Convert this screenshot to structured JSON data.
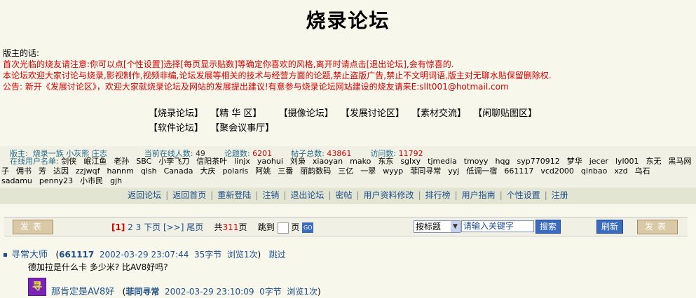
{
  "title": "烧录论坛",
  "notice": {
    "head": "版主的话:",
    "line1": "首次光临的烧友请注意:你可以点[个性设置]选择[每页显示贴数]等确定你喜欢的风格,离开时请点击[退出论坛],会有惊喜的.",
    "line2": "本论坛欢迎大家讨论与烧录,影视制作,视频非编,论坛发展等相关的技术与经营方面的论题,禁止盗版广告,禁止不文明词语,版主对无聊水贴保留删除权.",
    "line3": "公告: 新开《发展讨论区》，欢迎大家就烧录论坛及网站的发展提出建议!有意参与烧录论坛网站建设的烧友请来E:sllt001@hotmail.com"
  },
  "nav": {
    "row1": [
      "【烧录论坛】",
      "【精 华 区】",
      "【摄像论坛】",
      "【发展讨论区】",
      "【素材交流】",
      "【闲聊贴图区】"
    ],
    "row2": [
      "【软件论坛】",
      "【聚会议事厅】"
    ]
  },
  "stats": {
    "moderators_label": "版主:",
    "moderators": "烧录一族 小灰熊 庄志",
    "online_label": "当前在线人数:",
    "online": "49",
    "topics_label": "论题数:",
    "topics": "6201",
    "posts_label": "帖子总数:",
    "posts": "43861",
    "visits_label": "访问数:",
    "visits": "11792"
  },
  "online_users": {
    "label": "在线用户名单:",
    "users": [
      "剑侠",
      "岷江鱼",
      "老孙",
      "SBC",
      "小李飞刀",
      "信阳茶叶",
      "linjx",
      "yaohui",
      "刘枭",
      "xiaoyan",
      "mako",
      "东东",
      "sglxy",
      "tjmedia",
      "tmoyy",
      "hqg",
      "syp770912",
      "梦华",
      "jecer",
      "lyl001",
      "东无",
      "黑马网子",
      "佣书",
      "芳",
      "达因",
      "zzjwqf",
      "hannm",
      "qlsh",
      "Canada",
      "大庆",
      "polaris",
      "阿姚",
      "三番",
      "丽韵数码",
      "三亿",
      "一翠",
      "wyyp",
      "菲同寻常",
      "yyj",
      "低调一宿",
      "661117",
      "vcd2000",
      "qinbao",
      "xzd",
      "乌石",
      "sadamu",
      "penny23",
      "小市民",
      "gjh"
    ]
  },
  "menu": [
    "返回论坛",
    "返回首页",
    "重新登陆",
    "注销",
    "退出论坛",
    "密帖",
    "用户资料修改",
    "排行榜",
    "用户指南",
    "个性设置",
    "注册"
  ],
  "pager": {
    "post_btn": "发表",
    "current": "[1]",
    "p2": "2",
    "p3": "3",
    "next": "下页",
    "more": "[>>]",
    "last": "尾页",
    "total_prefix": "共",
    "total": "311",
    "total_suffix": "页",
    "jump_label": "跳到",
    "page_label": "页",
    "go": "GO",
    "search_type": "按标题",
    "keyword_placeholder": "请输入关键字",
    "search_btn": "搜索",
    "refresh_btn": "刷新",
    "post_btn2": "发表"
  },
  "posts": [
    {
      "author": "寻常大师",
      "id": "661117",
      "date": "2002-03-29 23:07:44",
      "bytes": "35字节",
      "views": "浏览1次",
      "action": "跳过",
      "body": "德加拉是什么卡 多少米? 比AV8好吗?"
    },
    {
      "subject": "那肯定是AV8好",
      "author": "菲同寻常",
      "date": "2002-03-29 23:10:09",
      "bytes": "0字节",
      "views": "浏览1次",
      "icon_char": "寻"
    }
  ]
}
